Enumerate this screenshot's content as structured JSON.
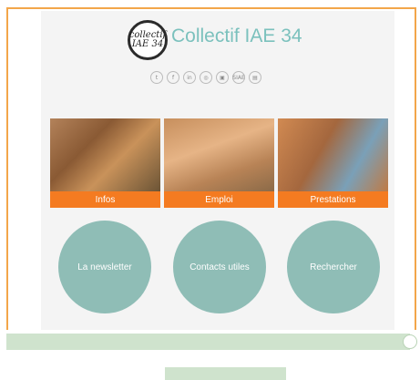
{
  "header": {
    "title": "Collectif IAE 34",
    "logo_text": "collectif IAE 34"
  },
  "socials": [
    {
      "icon": "twitter-icon",
      "glyph": "t"
    },
    {
      "icon": "facebook-icon",
      "glyph": "f"
    },
    {
      "icon": "linkedin-icon",
      "glyph": "in"
    },
    {
      "icon": "instagram-icon",
      "glyph": "◎"
    },
    {
      "icon": "logo-icon-1",
      "glyph": "▣"
    },
    {
      "icon": "siae-icon",
      "glyph": "SIAE"
    },
    {
      "icon": "logo-icon-2",
      "glyph": "▤"
    }
  ],
  "tiles": [
    {
      "label": "Infos"
    },
    {
      "label": "Emploi"
    },
    {
      "label": "Prestations"
    }
  ],
  "circles": [
    {
      "label": "La newsletter"
    },
    {
      "label": "Contacts utiles"
    },
    {
      "label": "Rechercher"
    }
  ],
  "colors": {
    "accent_orange": "#f47b21",
    "teal": "#8fbdb6",
    "title_teal": "#7bc1bd",
    "frame_border": "#f3a64a",
    "green_bar": "#cfe3cd"
  }
}
